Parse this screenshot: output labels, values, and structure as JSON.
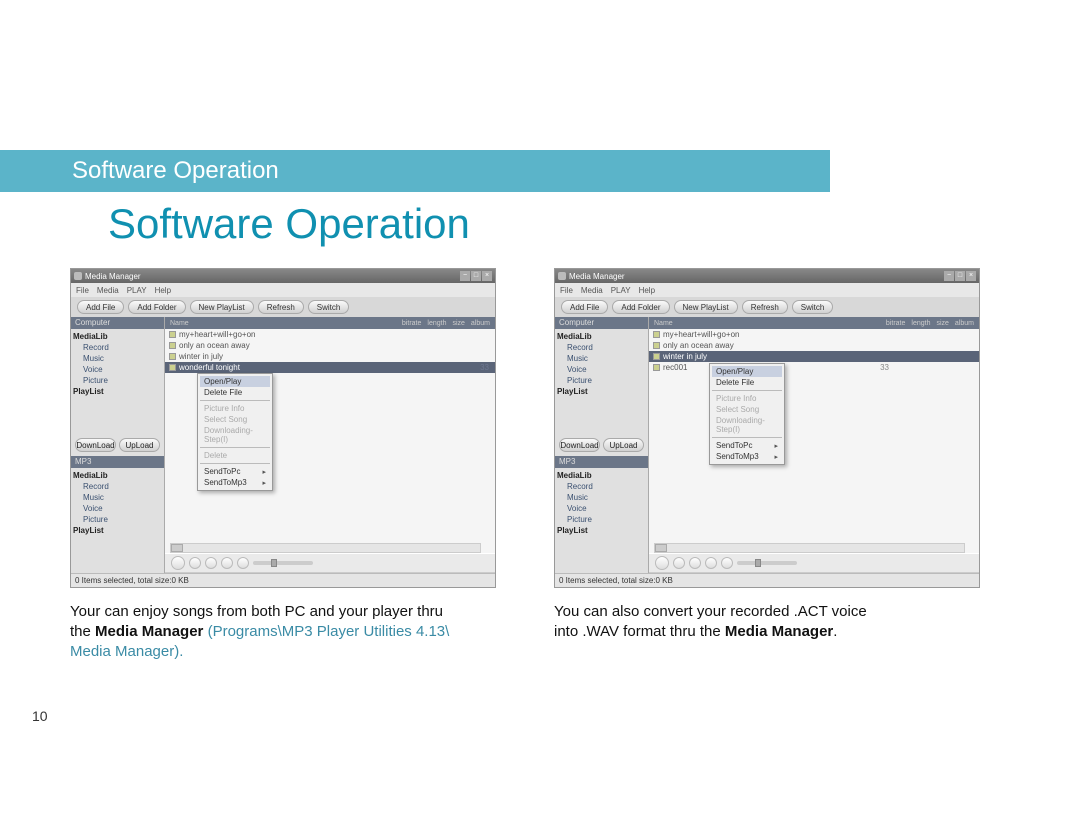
{
  "header": {
    "running_title": "Software Operation"
  },
  "main_title": "Software Operation",
  "page_number": "10",
  "app": {
    "window_title": "Media Manager",
    "menus": [
      "File",
      "Media",
      "PLAY",
      "Help"
    ],
    "toolbar": [
      "Add File",
      "Add Folder",
      "New PlayList",
      "Refresh",
      "Switch"
    ],
    "sidebar": {
      "header_computer": "Computer",
      "header_mp3": "MP3",
      "tree": {
        "root": "MediaLib",
        "items": [
          "Record",
          "Music",
          "Voice",
          "Picture"
        ],
        "playlist": "PlayList"
      },
      "buttons": {
        "download": "DownLoad",
        "upload": "UpLoad"
      }
    },
    "list": {
      "headers": {
        "name": "Name",
        "cols": [
          "bitrate",
          "length",
          "size",
          "album"
        ]
      }
    },
    "statusbar": "0 Items selected, total size:0 KB"
  },
  "left": {
    "rows": [
      "my+heart+will+go+on",
      "only an ocean away",
      "winter in july"
    ],
    "selected_row": "wonderful tonight",
    "selected_num": "33",
    "context_menu": {
      "items": [
        {
          "label": "Open/Play",
          "hl": true
        },
        {
          "label": "Delete File"
        },
        {
          "label": "Picture Info",
          "disabled": true
        },
        {
          "label": "Select Song",
          "disabled": true
        },
        {
          "label": "Downloading-Step(I)",
          "disabled": true
        },
        {
          "label": "Delete",
          "disabled": true
        }
      ],
      "submenu": [
        {
          "label": "SendToPc",
          "arrow": true
        },
        {
          "label": "SendToMp3",
          "arrow": true
        }
      ]
    },
    "caption": {
      "line1": "Your can enjoy songs from both PC and your player thru",
      "line2a": "the ",
      "line2b_bold": "Media Manager",
      "line2c_path": " (Programs\\MP3 Player Utilities 4.13\\",
      "line3_path": "Media Manager)",
      "line3_dot": "."
    }
  },
  "right": {
    "rows": [
      "my+heart+will+go+on",
      "only an ocean away"
    ],
    "selected_row": "winter in july",
    "extra_row": "rec001",
    "selected_num": "33",
    "context_menu": {
      "items": [
        {
          "label": "Open/Play",
          "hl": true
        },
        {
          "label": "Delete File"
        },
        {
          "label": "Picture Info",
          "disabled": true
        },
        {
          "label": "Select Song",
          "disabled": true
        },
        {
          "label": "Downloading-Step(I)",
          "disabled": true
        }
      ],
      "submenu": [
        {
          "label": "SendToPc",
          "arrow": true
        },
        {
          "label": "SendToMp3",
          "arrow": true
        }
      ]
    },
    "caption": {
      "line1": "You can also convert your recorded .ACT voice",
      "line2a": "into .WAV format thru the ",
      "line2b_bold": "Media Manager",
      "line2c": "."
    }
  }
}
